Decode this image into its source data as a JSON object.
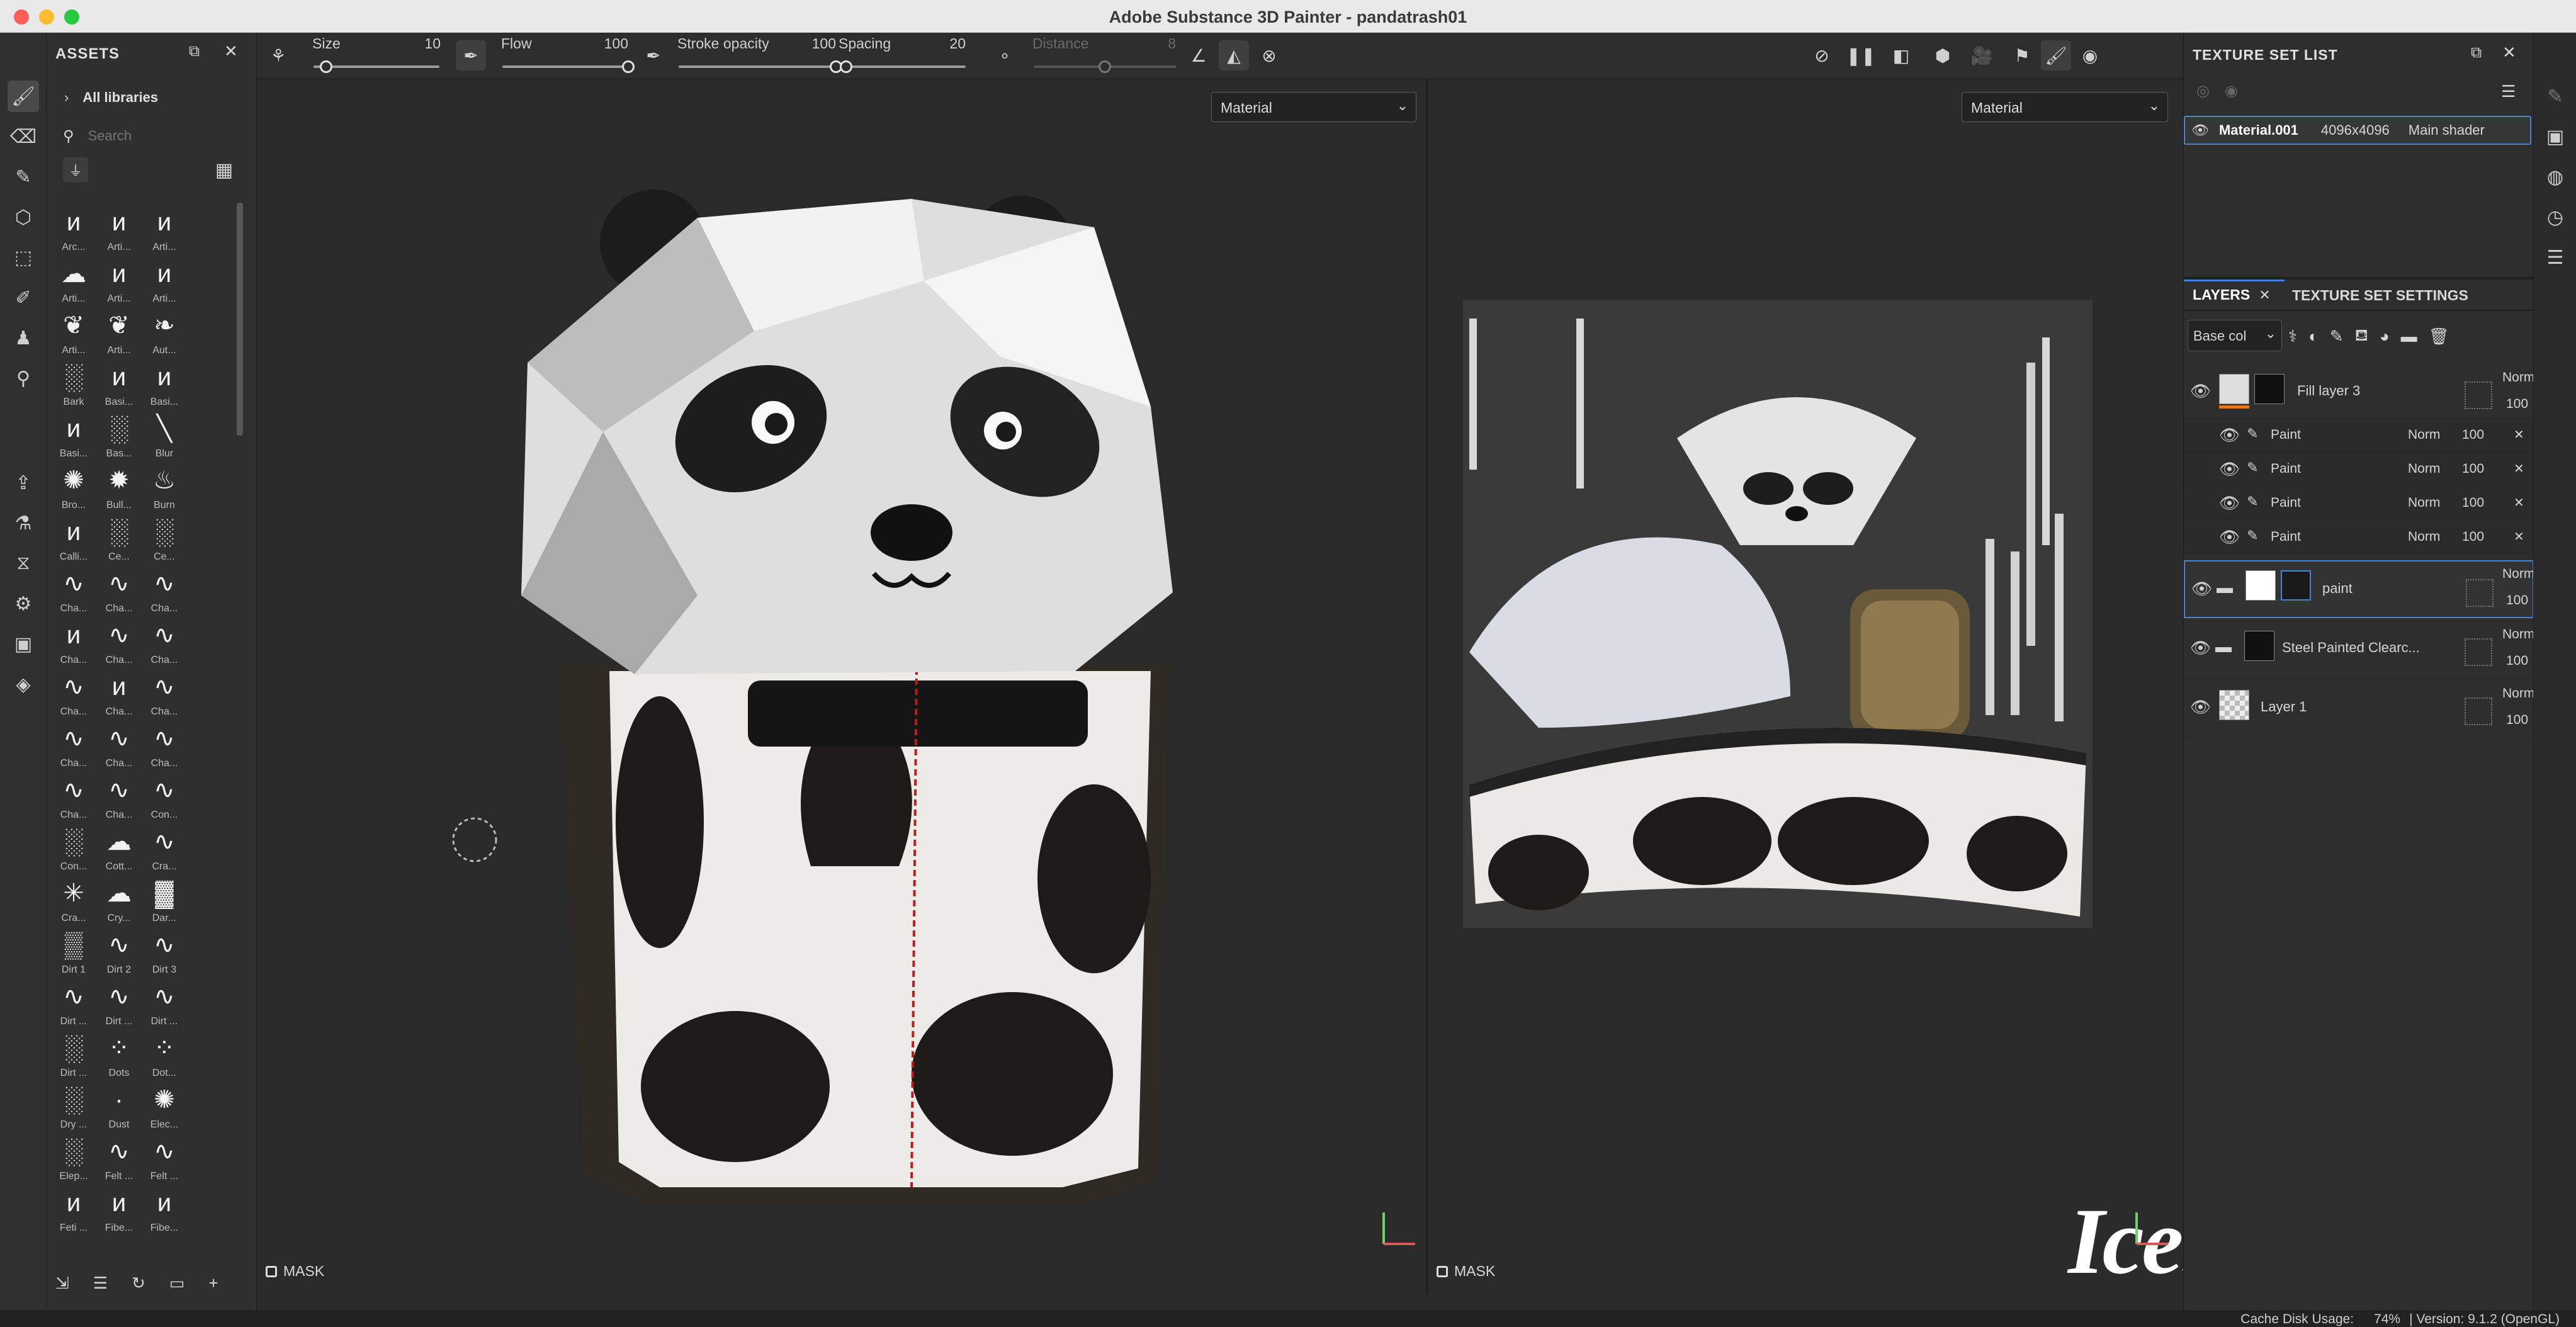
{
  "window": {
    "title": "Adobe Substance 3D Painter - pandatrash01",
    "traffic_lights": {
      "close": "#fe5f57",
      "minimize": "#febc2e",
      "zoom": "#28c840"
    }
  },
  "left_tools": [
    "brush-icon",
    "eraser-icon",
    "pen-icon",
    "fill-cube-icon",
    "selection-icon",
    "smudge-icon",
    "clone-stamp-icon",
    "color-picker-icon",
    "export-icon",
    "bake-icon",
    "history-icon",
    "settings-icon",
    "screenshot-icon",
    "layers-icon"
  ],
  "assets": {
    "title": "ASSETS",
    "library": "All libraries",
    "search_placeholder": "Search",
    "thumbnails": [
      {
        "label": "Arc...",
        "glyph": "ᴎ"
      },
      {
        "label": "Arti...",
        "glyph": "ᴎ"
      },
      {
        "label": "Arti...",
        "glyph": "ᴎ"
      },
      {
        "label": "Arti...",
        "glyph": "☁"
      },
      {
        "label": "Arti...",
        "glyph": "ᴎ"
      },
      {
        "label": "Arti...",
        "glyph": "ᴎ"
      },
      {
        "label": "Arti...",
        "glyph": "❦"
      },
      {
        "label": "Arti...",
        "glyph": "❦"
      },
      {
        "label": "Aut...",
        "glyph": "❧"
      },
      {
        "label": "Bark",
        "glyph": "░"
      },
      {
        "label": "Basi...",
        "glyph": "ᴎ"
      },
      {
        "label": "Basi...",
        "glyph": "ᴎ"
      },
      {
        "label": "Basi...",
        "glyph": "ᴎ"
      },
      {
        "label": "Bas...",
        "glyph": "░"
      },
      {
        "label": "Blur",
        "glyph": "╲"
      },
      {
        "label": "Bro...",
        "glyph": "✺"
      },
      {
        "label": "Bull...",
        "glyph": "✹"
      },
      {
        "label": "Burn",
        "glyph": "♨"
      },
      {
        "label": "Calli...",
        "glyph": "ᴎ"
      },
      {
        "label": "Ce...",
        "glyph": "░"
      },
      {
        "label": "Ce...",
        "glyph": "░"
      },
      {
        "label": "Cha...",
        "glyph": "∿"
      },
      {
        "label": "Cha...",
        "glyph": "∿"
      },
      {
        "label": "Cha...",
        "glyph": "∿"
      },
      {
        "label": "Cha...",
        "glyph": "ᴎ"
      },
      {
        "label": "Cha...",
        "glyph": "∿"
      },
      {
        "label": "Cha...",
        "glyph": "∿"
      },
      {
        "label": "Cha...",
        "glyph": "∿"
      },
      {
        "label": "Cha...",
        "glyph": "ᴎ"
      },
      {
        "label": "Cha...",
        "glyph": "∿"
      },
      {
        "label": "Cha...",
        "glyph": "∿"
      },
      {
        "label": "Cha...",
        "glyph": "∿"
      },
      {
        "label": "Cha...",
        "glyph": "∿"
      },
      {
        "label": "Cha...",
        "glyph": "∿"
      },
      {
        "label": "Cha...",
        "glyph": "∿"
      },
      {
        "label": "Con...",
        "glyph": "∿"
      },
      {
        "label": "Con...",
        "glyph": "░"
      },
      {
        "label": "Cott...",
        "glyph": "☁"
      },
      {
        "label": "Cra...",
        "glyph": "∿"
      },
      {
        "label": "Cra...",
        "glyph": "✳"
      },
      {
        "label": "Cry...",
        "glyph": "☁"
      },
      {
        "label": "Dar...",
        "glyph": "▓"
      },
      {
        "label": "Dirt 1",
        "glyph": "▒"
      },
      {
        "label": "Dirt 2",
        "glyph": "∿"
      },
      {
        "label": "Dirt 3",
        "glyph": "∿"
      },
      {
        "label": "Dirt ...",
        "glyph": "∿"
      },
      {
        "label": "Dirt ...",
        "glyph": "∿"
      },
      {
        "label": "Dirt ...",
        "glyph": "∿"
      },
      {
        "label": "Dirt ...",
        "glyph": "░"
      },
      {
        "label": "Dots",
        "glyph": "⁘"
      },
      {
        "label": "Dot...",
        "glyph": "⁘"
      },
      {
        "label": "Dry ...",
        "glyph": "░"
      },
      {
        "label": "Dust",
        "glyph": "·"
      },
      {
        "label": "Elec...",
        "glyph": "✺"
      },
      {
        "label": "Elep...",
        "glyph": "░"
      },
      {
        "label": "Felt ...",
        "glyph": "∿"
      },
      {
        "label": "Felt ...",
        "glyph": "∿"
      },
      {
        "label": "Feti ...",
        "glyph": "ᴎ"
      },
      {
        "label": "Fibe...",
        "glyph": "ᴎ"
      },
      {
        "label": "Fibe...",
        "glyph": "ᴎ"
      }
    ]
  },
  "options": {
    "size_label": "Size",
    "size_value": "10",
    "size_level": 0.1,
    "flow_label": "Flow",
    "flow_value": "100",
    "flow_level": 1.0,
    "stroke_opacity_label": "Stroke opacity",
    "stroke_opacity_value": "100",
    "stroke_opacity_level": 1.0,
    "spacing_label": "Spacing",
    "spacing_value": "20",
    "spacing_level": 0.05,
    "distance_label": "Distance",
    "distance_value": "8",
    "distance_level": 0.5
  },
  "viewport_3d": {
    "channel": "Material",
    "mask_label": "MASK"
  },
  "viewport_2d": {
    "channel": "Material",
    "mask_label": "MASK"
  },
  "watermark": "IceStyleCG",
  "texture_set_list": {
    "title": "TEXTURE SET LIST",
    "material_name": "Material.001",
    "resolution": "4096x4096",
    "shader": "Main shader"
  },
  "layers": {
    "tab_layers": "LAYERS",
    "tab_texture_settings": "TEXTURE SET SETTINGS",
    "channel_select": "Base col",
    "items": [
      {
        "name": "Fill layer 3",
        "blend": "Norm",
        "opacity": "100",
        "kind": "fill"
      },
      {
        "name": "Paint",
        "blend": "Norm",
        "opacity": "100",
        "kind": "effect"
      },
      {
        "name": "Paint",
        "blend": "Norm",
        "opacity": "100",
        "kind": "effect"
      },
      {
        "name": "Paint",
        "blend": "Norm",
        "opacity": "100",
        "kind": "effect"
      },
      {
        "name": "Paint",
        "blend": "Norm",
        "opacity": "100",
        "kind": "effect"
      },
      {
        "name": "paint",
        "blend": "Norm",
        "opacity": "100",
        "kind": "folder"
      },
      {
        "name": "Steel Painted Clearc...",
        "blend": "Norm",
        "opacity": "100",
        "kind": "folder"
      },
      {
        "name": "Layer 1",
        "blend": "Norm",
        "opacity": "100",
        "kind": "layer"
      }
    ]
  },
  "status": {
    "cache_label": "Cache Disk Usage:",
    "cache_value": "74%",
    "version": "| Version: 9.1.2 (OpenGL)"
  }
}
